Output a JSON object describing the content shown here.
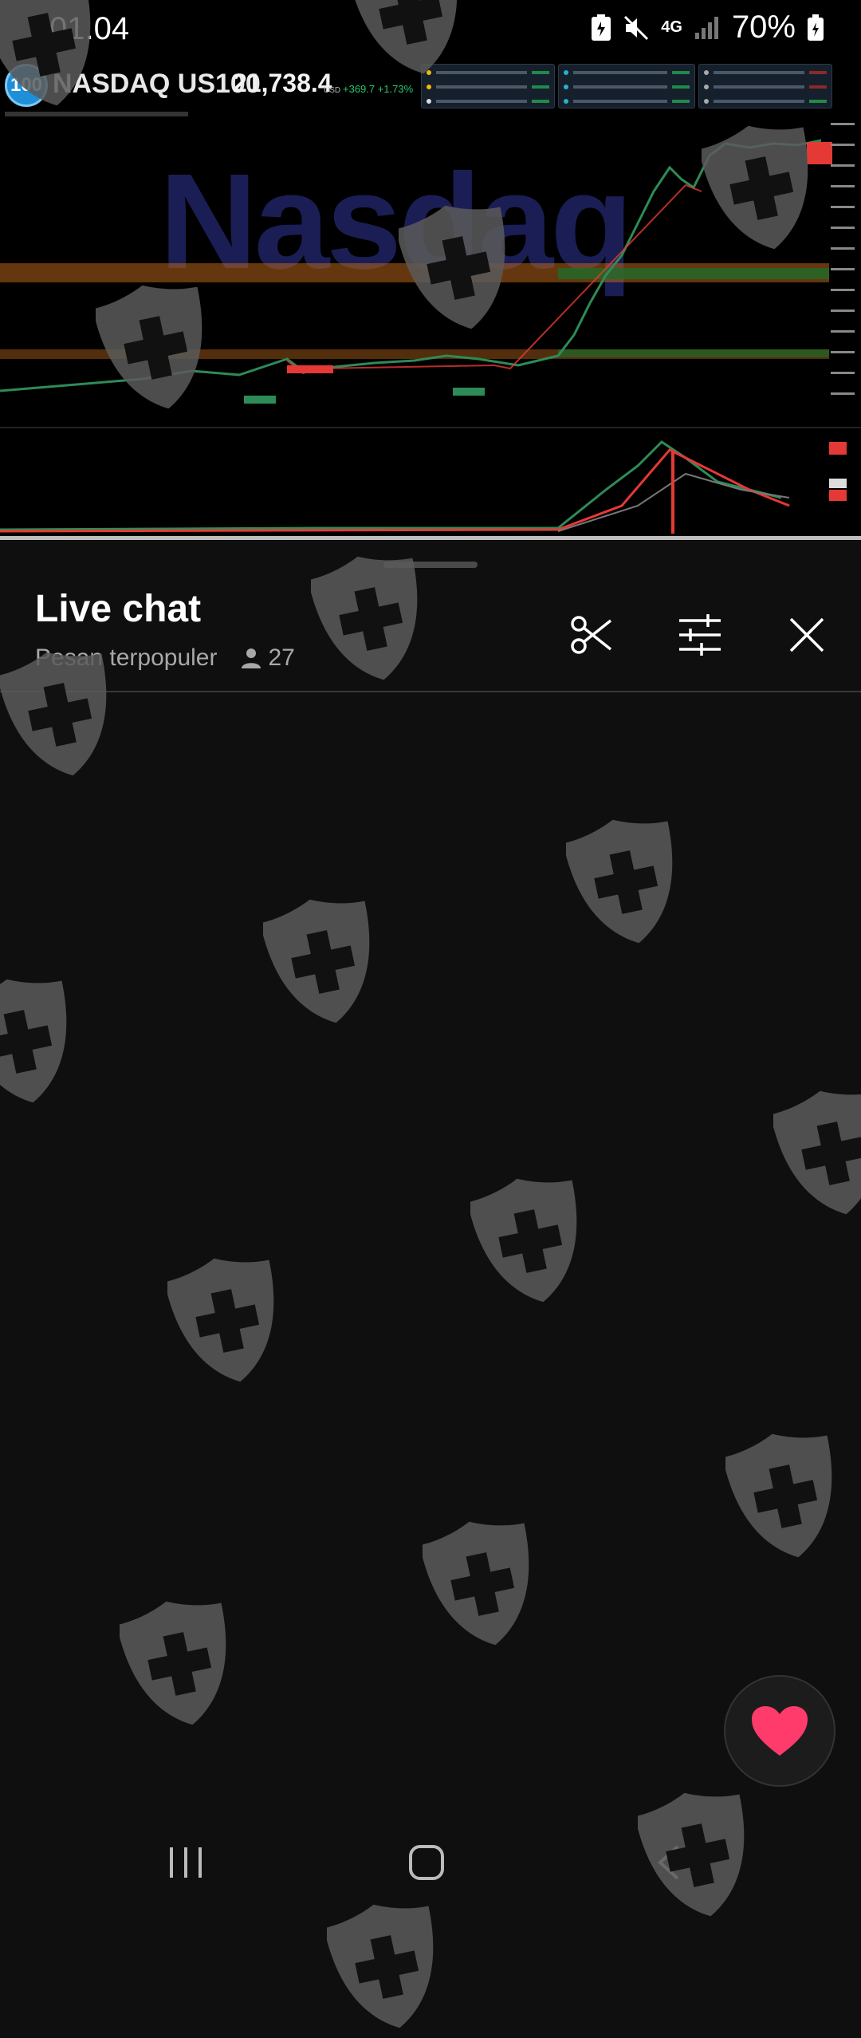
{
  "status_bar": {
    "time": "01.04",
    "network": "4G",
    "battery": "70%"
  },
  "video": {
    "badge": "100",
    "symbol": "NASDAQ US100",
    "price": "21,738.4",
    "currency": "USD",
    "change": "+369.7 +1.73%",
    "background_word": "Nasdaq",
    "colors": {
      "up": "#28c76f",
      "down": "#e53935",
      "orange_band": "#b8651a",
      "green_band": "#1f6b2a"
    }
  },
  "chat": {
    "title": "Live chat",
    "mode": "Pesan terpopuler",
    "viewer_count": "27"
  },
  "icons": {
    "clip": "scissors-icon",
    "filter": "sliders-icon",
    "close": "close-icon",
    "like": "heart-icon"
  },
  "navigation": [
    "recent-apps",
    "home",
    "back"
  ],
  "colors": {
    "panel_bg": "#0f0f0f",
    "heart": "#ff3b6b",
    "watermark": "#5a5a5a"
  }
}
